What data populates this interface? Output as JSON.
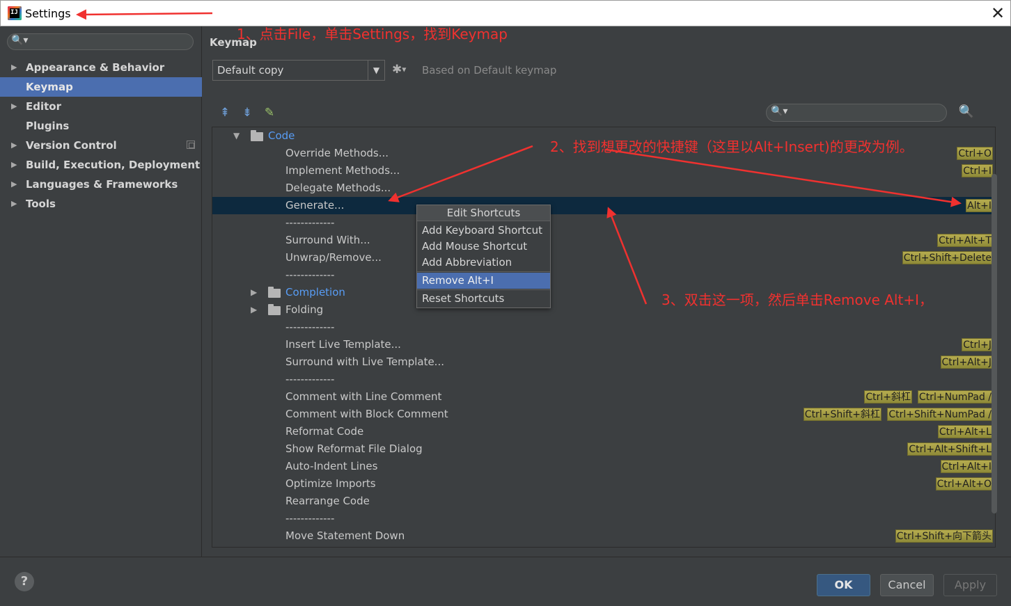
{
  "window": {
    "title": "Settings",
    "app_icon_letter": "IJ",
    "close_glyph": "✕"
  },
  "sidebar": {
    "search_icon": "🔍▾",
    "items": [
      {
        "label": "Appearance & Behavior",
        "arrow": "▶"
      },
      {
        "label": "Keymap",
        "arrow": ""
      },
      {
        "label": "Editor",
        "arrow": "▶"
      },
      {
        "label": "Plugins",
        "arrow": ""
      },
      {
        "label": "Version Control",
        "arrow": "▶"
      },
      {
        "label": "Build, Execution, Deployment",
        "arrow": "▶"
      },
      {
        "label": "Languages & Frameworks",
        "arrow": "▶"
      },
      {
        "label": "Tools",
        "arrow": "▶"
      }
    ]
  },
  "main": {
    "section_title": "Keymap",
    "keymap_value": "Default copy",
    "dropdown_glyph": "▼",
    "gear_glyph": "✱",
    "based_on": "Based on Default keymap",
    "toolbar": {
      "expand_all": "⇞",
      "collapse_all": "⇟",
      "edit": "✎",
      "search_icon": "🔍▾",
      "find_shortcut": "🔍"
    }
  },
  "tree": {
    "rows": [
      {
        "label": "Code",
        "expander": "▼"
      },
      {
        "label": "Override Methods...",
        "shortcuts": [
          "Ctrl+O"
        ]
      },
      {
        "label": "Implement Methods...",
        "shortcuts": [
          "Ctrl+I"
        ]
      },
      {
        "label": "Delegate Methods...",
        "shortcuts": []
      },
      {
        "label": "Generate...",
        "shortcuts": [
          "Alt+I"
        ]
      },
      {
        "label": "-------------",
        "shortcuts": []
      },
      {
        "label": "Surround With...",
        "shortcuts": [
          "Ctrl+Alt+T"
        ]
      },
      {
        "label": "Unwrap/Remove...",
        "shortcuts": [
          "Ctrl+Shift+Delete"
        ]
      },
      {
        "label": "-------------",
        "shortcuts": []
      },
      {
        "label": "Completion",
        "expander": "▶"
      },
      {
        "label": "Folding",
        "expander": "▶"
      },
      {
        "label": "-------------",
        "shortcuts": []
      },
      {
        "label": "Insert Live Template...",
        "shortcuts": [
          "Ctrl+J"
        ]
      },
      {
        "label": "Surround with Live Template...",
        "shortcuts": [
          "Ctrl+Alt+J"
        ]
      },
      {
        "label": "-------------",
        "shortcuts": []
      },
      {
        "label": "Comment with Line Comment",
        "shortcuts": [
          "Ctrl+斜杠",
          "Ctrl+NumPad /"
        ]
      },
      {
        "label": "Comment with Block Comment",
        "shortcuts": [
          "Ctrl+Shift+斜杠",
          "Ctrl+Shift+NumPad /"
        ]
      },
      {
        "label": "Reformat Code",
        "shortcuts": [
          "Ctrl+Alt+L"
        ]
      },
      {
        "label": "Show Reformat File Dialog",
        "shortcuts": [
          "Ctrl+Alt+Shift+L"
        ]
      },
      {
        "label": "Auto-Indent Lines",
        "shortcuts": [
          "Ctrl+Alt+I"
        ]
      },
      {
        "label": "Optimize Imports",
        "shortcuts": [
          "Ctrl+Alt+O"
        ]
      },
      {
        "label": "Rearrange Code",
        "shortcuts": []
      },
      {
        "label": "-------------",
        "shortcuts": []
      },
      {
        "label": "Move Statement Down",
        "shortcuts": [
          "Ctrl+Shift+向下箭头"
        ]
      }
    ]
  },
  "popup": {
    "header": "Edit Shortcuts",
    "items": [
      "Add Keyboard Shortcut",
      "Add Mouse Shortcut",
      "Add Abbreviation",
      "Remove Alt+I",
      "Reset Shortcuts"
    ]
  },
  "footer": {
    "help": "?",
    "ok": "OK",
    "cancel": "Cancel",
    "apply": "Apply"
  },
  "annotations": {
    "step1": "1、点击File，单击Settings，找到Keymap",
    "step2": "2、找到想更改的快捷键（这里以Alt+Insert)的更改为例。",
    "step3": "3、双击这一项，然后单击Remove Alt+I，",
    "color": "#f0312f"
  }
}
